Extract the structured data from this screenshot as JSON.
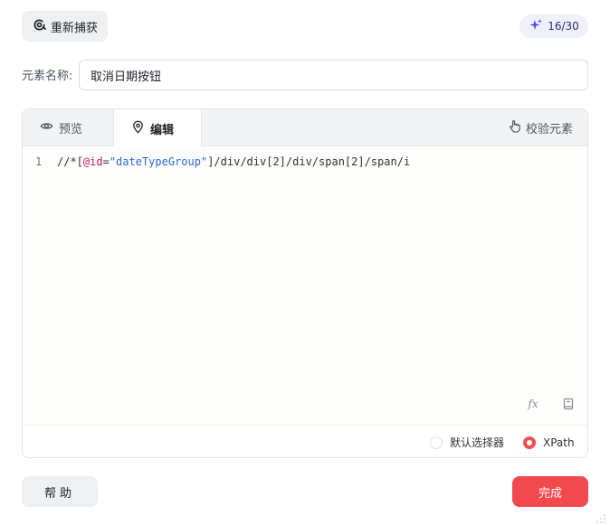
{
  "header": {
    "recapture_label": "重新捕获",
    "counter": "16/30"
  },
  "name_field": {
    "label": "元素名称:",
    "value": "取消日期按钮"
  },
  "editor": {
    "tabs": [
      {
        "label": "预览",
        "icon": "eye-icon",
        "active": false
      },
      {
        "label": "编辑",
        "icon": "location-pin-icon",
        "active": true
      }
    ],
    "validate_label": "校验元素",
    "line_number": "1",
    "code": {
      "prefix": "//*[",
      "attr": "@id",
      "eq": "=",
      "string": "\"dateTypeGroup\"",
      "suffix": "]/div/div[2]/div/span[2]/span/i"
    },
    "fx_label": "fx",
    "selector_options": [
      {
        "label": "默认选择器",
        "checked": false
      },
      {
        "label": "XPath",
        "checked": true
      }
    ]
  },
  "footer": {
    "help_label": "帮助",
    "done_label": "完成"
  },
  "colors": {
    "accent": "#f2494f",
    "code_attr": "#c2185b",
    "code_string": "#2f6bd6"
  }
}
